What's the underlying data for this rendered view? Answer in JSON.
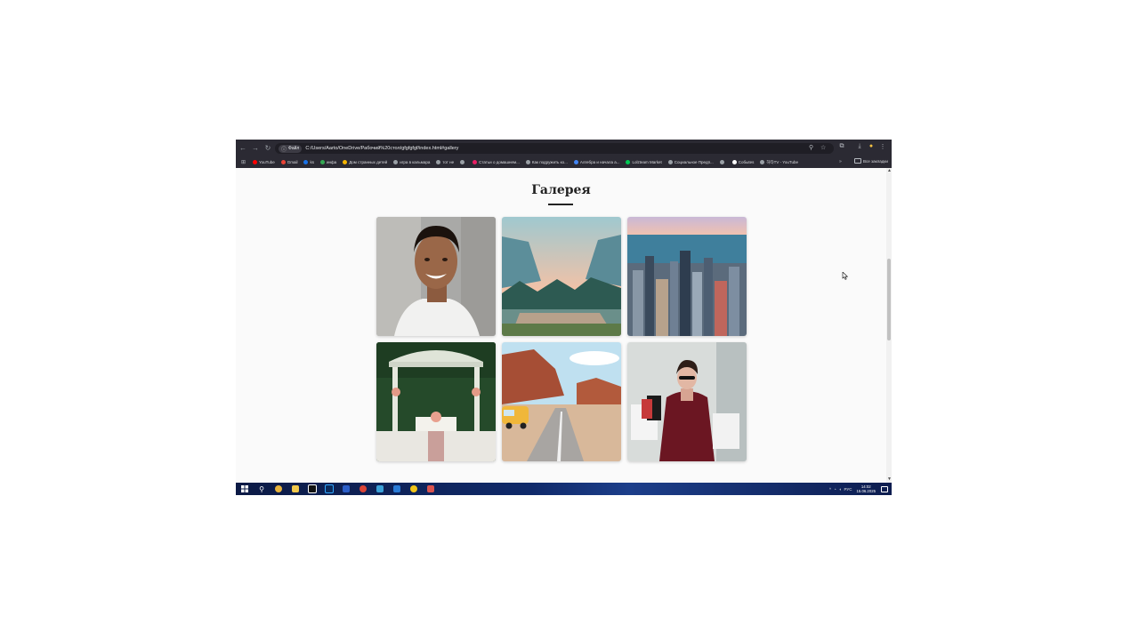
{
  "browser": {
    "nav": {
      "back_icon": "←",
      "forward_icon": "→",
      "reload_icon": "↻"
    },
    "site_info_label": "Файл",
    "url": "C:/Users/Aarto/OneDrive/Рабочий%20стол/gfgfgfgf/index.html#gallery",
    "bookmarks": [
      {
        "label": "YouTube",
        "color": "#ff0000"
      },
      {
        "label": "Gmail",
        "color": "#ea4335"
      },
      {
        "label": "ks",
        "color": "#1a73e8"
      },
      {
        "label": "инфа",
        "color": "#34a853"
      },
      {
        "label": "Дом странных детей",
        "color": "#f4b400"
      },
      {
        "label": "игра в кальмара",
        "color": "#9aa0a6"
      },
      {
        "label": "тот не",
        "color": "#9aa0a6"
      },
      {
        "label": "",
        "color": "#9aa0a6"
      },
      {
        "label": "Статьи о домашнем...",
        "color": "#e91e63"
      },
      {
        "label": "Как подружить ко...",
        "color": "#9aa0a6"
      },
      {
        "label": "Алгебра и начала а...",
        "color": "#4285f4"
      },
      {
        "label": "Lolzteam Market",
        "color": "#00c853"
      },
      {
        "label": "Социальное Предп...",
        "color": "#9aa0a6"
      },
      {
        "label": "",
        "color": "#9aa0a6"
      },
      {
        "label": "Собыtes",
        "color": "#ffffff"
      },
      {
        "label": "하타TV - YouTube",
        "color": "#9aa0a6"
      }
    ],
    "bookmarks_more": "»",
    "all_bookmarks_label": "Все закладки"
  },
  "page": {
    "title": "Галерея",
    "gallery": [
      {
        "name": "portrait-smiling-man"
      },
      {
        "name": "mountain-valley-river"
      },
      {
        "name": "city-skyline"
      },
      {
        "name": "wedding-gazebo"
      },
      {
        "name": "desert-road-van"
      },
      {
        "name": "woman-shopping-bags"
      }
    ]
  },
  "taskbar": {
    "tray_lang": "РУС",
    "clock_time": "14:02",
    "clock_date": "15.06.2025"
  }
}
